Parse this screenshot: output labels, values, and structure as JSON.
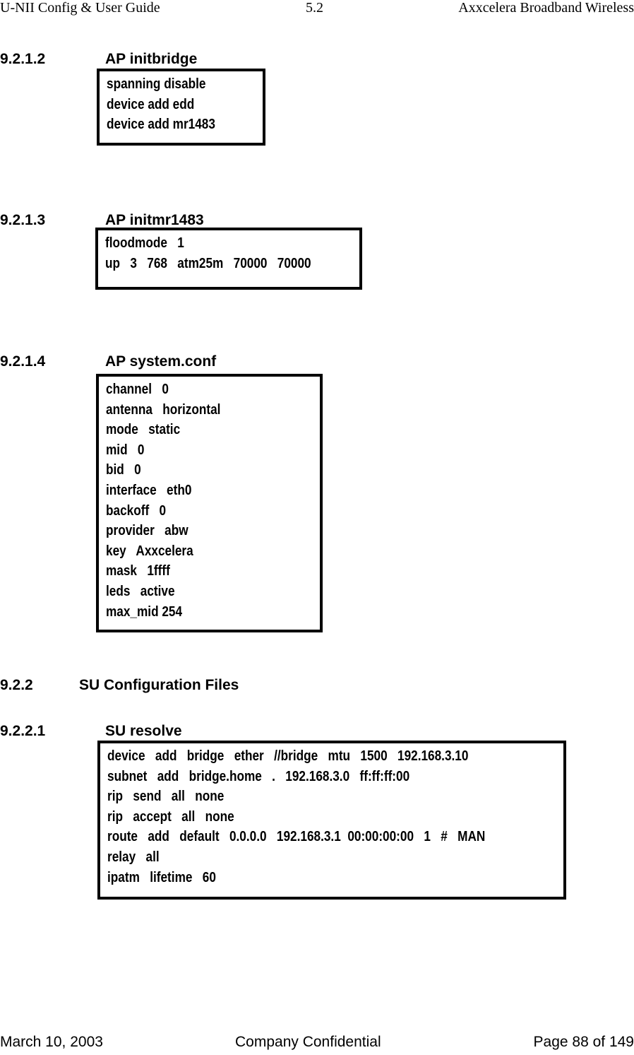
{
  "header": {
    "left": "U-NII Config & User Guide",
    "center": "5.2",
    "right": "Axxcelera Broadband Wireless"
  },
  "sections": [
    {
      "number": "9.2.1.2",
      "title": "AP initbridge",
      "lines": [
        "spanning disable",
        "device add edd",
        "device add mr1483"
      ]
    },
    {
      "number": "9.2.1.3",
      "title": "AP initmr1483",
      "lines": [
        "floodmode   1",
        "up   3   768   atm25m   70000   70000"
      ]
    },
    {
      "number": "9.2.1.4",
      "title": "AP system.conf",
      "lines": [
        "channel   0",
        "antenna   horizontal",
        "mode   static",
        "mid   0",
        "bid   0",
        "interface   eth0",
        "backoff   0",
        "provider   abw",
        "key   Axxcelera",
        "mask   1ffff",
        "leds   active",
        "max_mid 254"
      ]
    },
    {
      "number": "9.2.2",
      "title": "SU Configuration Files"
    },
    {
      "number": "9.2.2.1",
      "title": "SU resolve",
      "lines": [
        "device   add   bridge   ether   //bridge   mtu   1500   192.168.3.10",
        "subnet   add   bridge.home   .   192.168.3.0   ff:ff:ff:00",
        "rip   send   all   none",
        "rip   accept   all   none",
        "route   add   default   0.0.0.0   192.168.3.1  00:00:00:00   1   #   MAN",
        "relay   all",
        "ipatm   lifetime   60"
      ]
    }
  ],
  "footer": {
    "left": "March 10, 2003",
    "center": "Company Confidential",
    "right": "Page 88 of 149"
  }
}
